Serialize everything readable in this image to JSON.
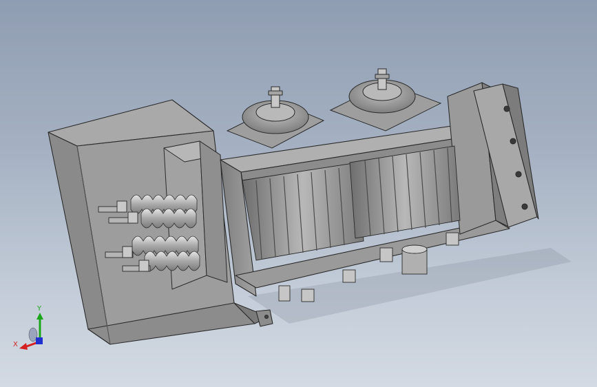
{
  "viewport": {
    "colors": {
      "background_top": "#8f9db2",
      "background_bottom": "#d3dae3",
      "part": "#9a9a9a",
      "edge": "#2a2a2a"
    }
  },
  "triad": {
    "x_label": "X",
    "y_label": "Y",
    "colors": {
      "x": "#d42020",
      "y": "#1aa51a",
      "z": "#2030d0"
    }
  }
}
